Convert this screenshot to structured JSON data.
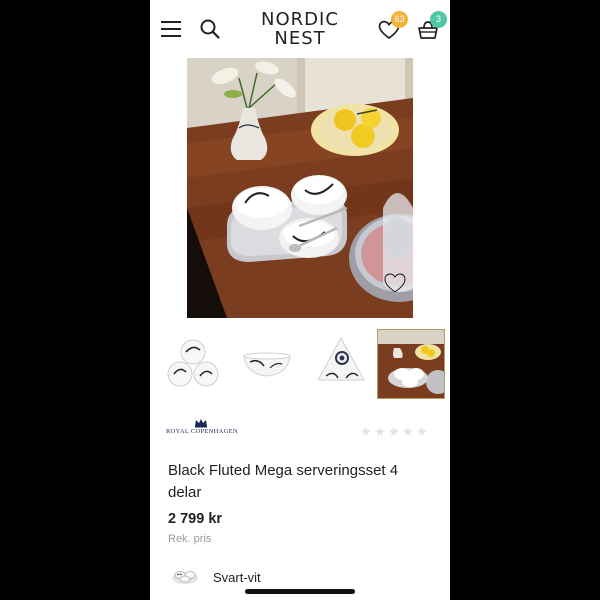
{
  "header": {
    "logo_line1": "NORDIC",
    "logo_line2": "NEST",
    "wishlist_count": "63",
    "cart_count": "3",
    "menu_icon": "hamburger-menu-icon",
    "search_icon": "search-icon",
    "wishlist_icon": "heart-icon",
    "cart_icon": "basket-icon"
  },
  "gallery": {
    "favorite_icon": "heart-outline-icon",
    "thumbnails": [
      "set-top-view",
      "bowl-side-view",
      "set-angled-view",
      "lifestyle-photo"
    ],
    "selected_index": 3
  },
  "product": {
    "brand": "ROYAL COPENHAGEN",
    "rating": 0,
    "rating_max": 5,
    "title": "Black Fluted Mega serveringsset 4 delar",
    "price": "2 799 kr",
    "price_note": "Rek. pris",
    "variant": "Svart-vit"
  },
  "colors": {
    "wishlist_badge": "#f4b13c",
    "cart_badge": "#4fc9a4",
    "selected_thumb_border": "#b89b64",
    "star_empty": "#e2e2e2",
    "brand_blue": "#1b2b55"
  }
}
